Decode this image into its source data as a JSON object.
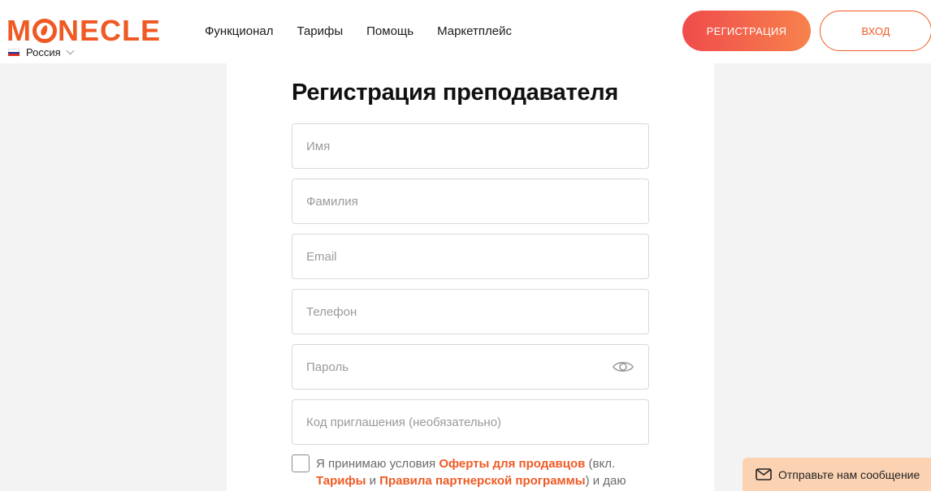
{
  "header": {
    "logo_before": "M",
    "logo_after": "NECLE",
    "region": "Россия",
    "nav": [
      "Функционал",
      "Тарифы",
      "Помощь",
      "Маркетплейс"
    ],
    "register_label": "РЕГИСТРАЦИЯ",
    "login_label": "ВХОД"
  },
  "form": {
    "title": "Регистрация преподавателя",
    "first_name_placeholder": "Имя",
    "last_name_placeholder": "Фамилия",
    "email_placeholder": "Email",
    "phone_placeholder": "Телефон",
    "password_placeholder": "Пароль",
    "invite_placeholder": "Код приглашения (необязательно)"
  },
  "agreement": {
    "prefix": "Я принимаю условия ",
    "offer_link": "Оферты для продавцов",
    "mid1": " (вкл. ",
    "tariffs_link": "Тарифы",
    "mid2": " и ",
    "partner_link": "Правила партнерской программы",
    "suffix": ") и даю"
  },
  "chat": {
    "label": "Отправьте нам сообщение"
  },
  "colors": {
    "brand": "#ef5a24",
    "chat_bg": "#fbd3b3"
  }
}
